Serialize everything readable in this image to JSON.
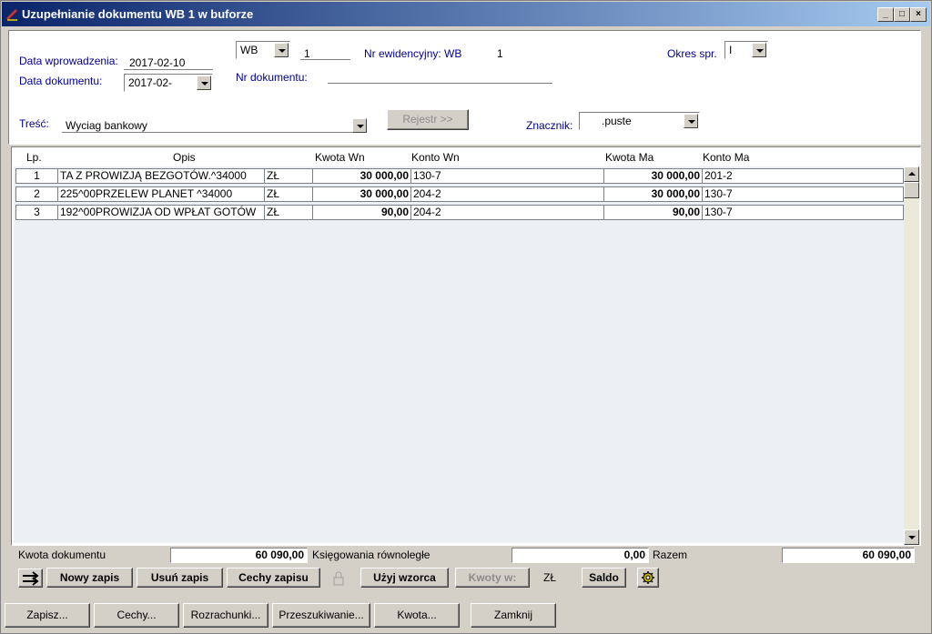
{
  "window": {
    "title": "Uzupełnianie dokumentu WB 1 w buforze",
    "controls": [
      "_",
      "□",
      "×"
    ]
  },
  "header": {
    "data_wprowadzenia_label": "Data wprowadzenia:",
    "data_wprowadzenia_value": "2017-02-10",
    "data_dokumentu_label": "Data dokumentu:",
    "data_dokumentu_value": "2017-02-",
    "doc_type_value": "WB",
    "doc_number_value": "1",
    "nr_ewidencyjny_label": "Nr ewidencyjny: WB",
    "nr_ewidencyjny_value": "1",
    "okres_label": "Okres spr.",
    "okres_value": "I",
    "nr_dokumentu_label": "Nr dokumentu:",
    "nr_dokumentu_value": "",
    "tresc_label": "Treść:",
    "tresc_value": "Wyciag bankowy",
    "rejestr_button": "Rejestr >>",
    "znacznik_label": "Znacznik:",
    "znacznik_value": ".puste"
  },
  "table": {
    "columns": [
      "Lp.",
      "Opis",
      "Kwota  Wn",
      "Konto  Wn",
      "Kwota Ma",
      "Konto Ma"
    ],
    "rows": [
      {
        "lp": "1",
        "opis": "TA Z PROWIZJĄ BEZGOTÓW.^34000",
        "waluta": "ZŁ",
        "kwota_wn": "30 000,00",
        "konto_wn": "130-7",
        "kwota_ma": "30 000,00",
        "konto_ma": "201-2"
      },
      {
        "lp": "2",
        "opis": "225^00PRZELEW PLANET ^34000",
        "waluta": "ZŁ",
        "kwota_wn": "30 000,00",
        "konto_wn": "204-2",
        "kwota_ma": "30 000,00",
        "konto_ma": "130-7"
      },
      {
        "lp": "3",
        "opis": "192^00PROWIZJA OD WPŁAT GOTÓW",
        "waluta": "ZŁ",
        "kwota_wn": "90,00",
        "konto_wn": "204-2",
        "kwota_ma": "90,00",
        "konto_ma": "130-7"
      }
    ]
  },
  "summary": {
    "kwota_dokumentu_label": "Kwota dokumentu",
    "kwota_dokumentu_value": "60 090,00",
    "ksiegowania_label": "Księgowania równoległe",
    "ksiegowania_value": "0,00",
    "razem_label": "Razem",
    "razem_value": "60 090,00"
  },
  "actions": {
    "nowy_zapis": "Nowy zapis",
    "usun_zapis": "Usuń zapis",
    "cechy_zapisu": "Cechy zapisu",
    "uzyj_wzorca": "Użyj wzorca",
    "kwoty_w": "Kwoty w:",
    "currency": "ZŁ",
    "saldo": "Saldo"
  },
  "bottom": {
    "zapisz": "Zapisz...",
    "cechy": "Cechy...",
    "rozrachunki": "Rozrachunki...",
    "przeszukiwanie": "Przeszukiwanie...",
    "kwota": "Kwota...",
    "zamknij": "Zamknij"
  },
  "colors": {
    "title_gradient_start": "#0a246a",
    "title_gradient_end": "#a6caf0",
    "label_blue": "#00008b",
    "face": "#d4d0c8"
  }
}
